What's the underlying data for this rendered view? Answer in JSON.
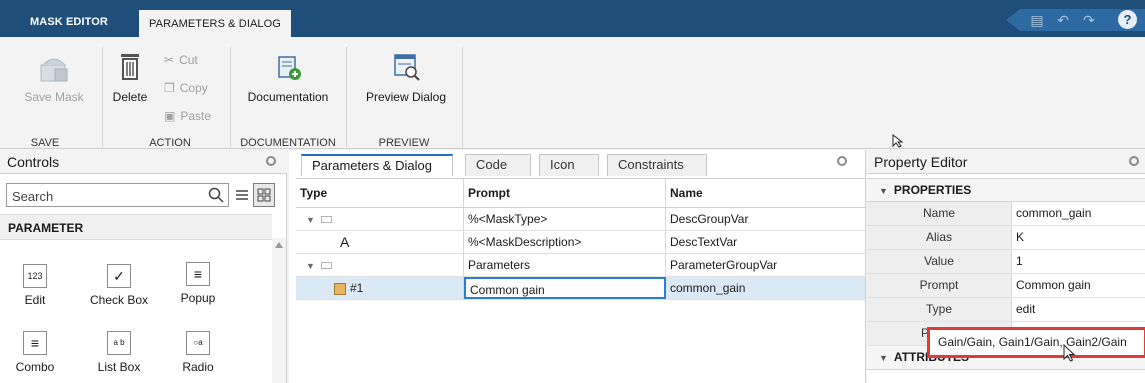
{
  "tabs": {
    "mask_editor": "MASK EDITOR",
    "parameters_dialog": "PARAMETERS & DIALOG"
  },
  "ribbon": {
    "save_mask": "Save Mask",
    "delete": "Delete",
    "cut": "Cut",
    "copy": "Copy",
    "paste": "Paste",
    "documentation": "Documentation",
    "preview_dialog": "Preview Dialog",
    "sections": {
      "save": "SAVE",
      "action": "ACTION",
      "documentation": "DOCUMENTATION",
      "preview": "PREVIEW"
    }
  },
  "controls": {
    "title": "Controls",
    "search_placeholder": "Search",
    "section": "PARAMETER",
    "items": [
      {
        "label": "Edit",
        "icon_text": "123"
      },
      {
        "label": "Check Box",
        "icon_text": "✓"
      },
      {
        "label": "Popup",
        "icon_text": "≡"
      },
      {
        "label": "Combo",
        "icon_text": "≡"
      },
      {
        "label": "List Box",
        "icon_text": "a b"
      },
      {
        "label": "Radio",
        "icon_text": "○a"
      }
    ]
  },
  "params_panel": {
    "tabs": [
      "Parameters & Dialog",
      "Code",
      "Icon",
      "Constraints"
    ],
    "columns": [
      "Type",
      "Prompt",
      "Name"
    ],
    "rows": [
      {
        "type": "",
        "prompt": "%<MaskType>",
        "name": "DescGroupVar"
      },
      {
        "type": "A",
        "prompt": "%<MaskDescription>",
        "name": "DescTextVar"
      },
      {
        "type": "",
        "prompt": "Parameters",
        "name": "ParameterGroupVar"
      },
      {
        "type": "#1",
        "prompt": "Common gain",
        "name": "common_gain"
      }
    ]
  },
  "property_editor": {
    "title": "Property Editor",
    "properties_section": "PROPERTIES",
    "attributes_section": "ATTRIBUTES",
    "rows": [
      {
        "key": "Name",
        "value": "common_gain"
      },
      {
        "key": "Alias",
        "value": "K"
      },
      {
        "key": "Value",
        "value": "1"
      },
      {
        "key": "Prompt",
        "value": "Common gain"
      },
      {
        "key": "Type",
        "value": "edit"
      },
      {
        "key": "P",
        "value": ""
      }
    ],
    "tooltip": "Gain/Gain, Gain1/Gain, Gain2/Gain"
  },
  "colors": {
    "accent": "#1e4e79",
    "selection": "#dbe8f6",
    "highlight_box": "#e03b3b"
  }
}
